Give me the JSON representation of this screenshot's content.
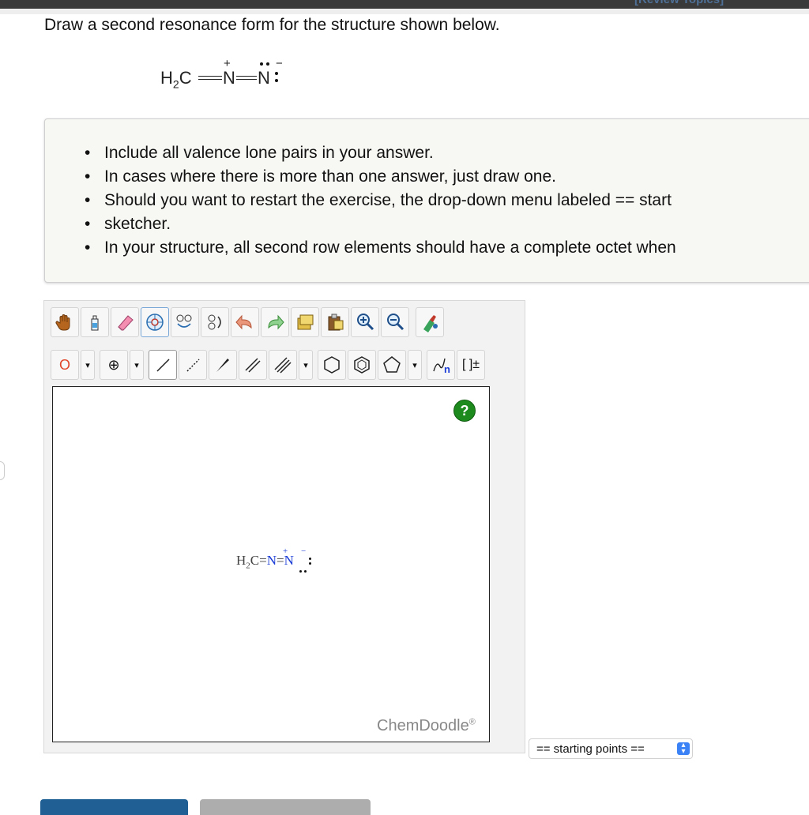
{
  "header": {
    "review_topics": "[Review Topics]"
  },
  "question": {
    "prompt": "Draw a second resonance form for the structure shown below.",
    "structure": {
      "atom1": "H",
      "atom1_sub": "2",
      "atom1_b": "C",
      "atom2": "N",
      "atom2_charge": "+",
      "atom3": "N",
      "atom3_charge": "−"
    }
  },
  "instructions": {
    "items": [
      "Include all valence lone pairs in your answer.",
      "In cases where there is more than one answer, just draw one.",
      "Should you want to restart the exercise, the drop-down menu labeled == start",
      "sketcher.",
      "In your structure, all second row elements should have a complete octet when"
    ]
  },
  "toolbar": {
    "row1": [
      "hand-icon",
      "lasso-icon",
      "eraser-icon",
      "template-icon",
      "ring-tool-icon",
      "rotate-icon",
      "undo-icon",
      "redo-icon",
      "copy-icon",
      "paste-icon",
      "zoom-in-icon",
      "zoom-out-icon",
      "clean-icon"
    ],
    "atom_label": "O",
    "charge_label": "⊕",
    "dropdown_glyph": "▾",
    "brackets_label": "[ ]±",
    "chain_label": "n"
  },
  "canvas": {
    "help": "?",
    "molecule": {
      "h": "H",
      "sub": "2",
      "c": "C",
      "eq1": "=",
      "n1": "N",
      "eq2": "=",
      "n2": "N",
      "plus": "+",
      "minus": "−"
    },
    "watermark": "ChemDoodle",
    "watermark_mark": "®"
  },
  "starting_points": {
    "selected": "== starting points =="
  },
  "colors": {
    "accent_blue": "#1f5f93",
    "help_green": "#1d8a1d",
    "select_blue": "#3b82f6"
  }
}
